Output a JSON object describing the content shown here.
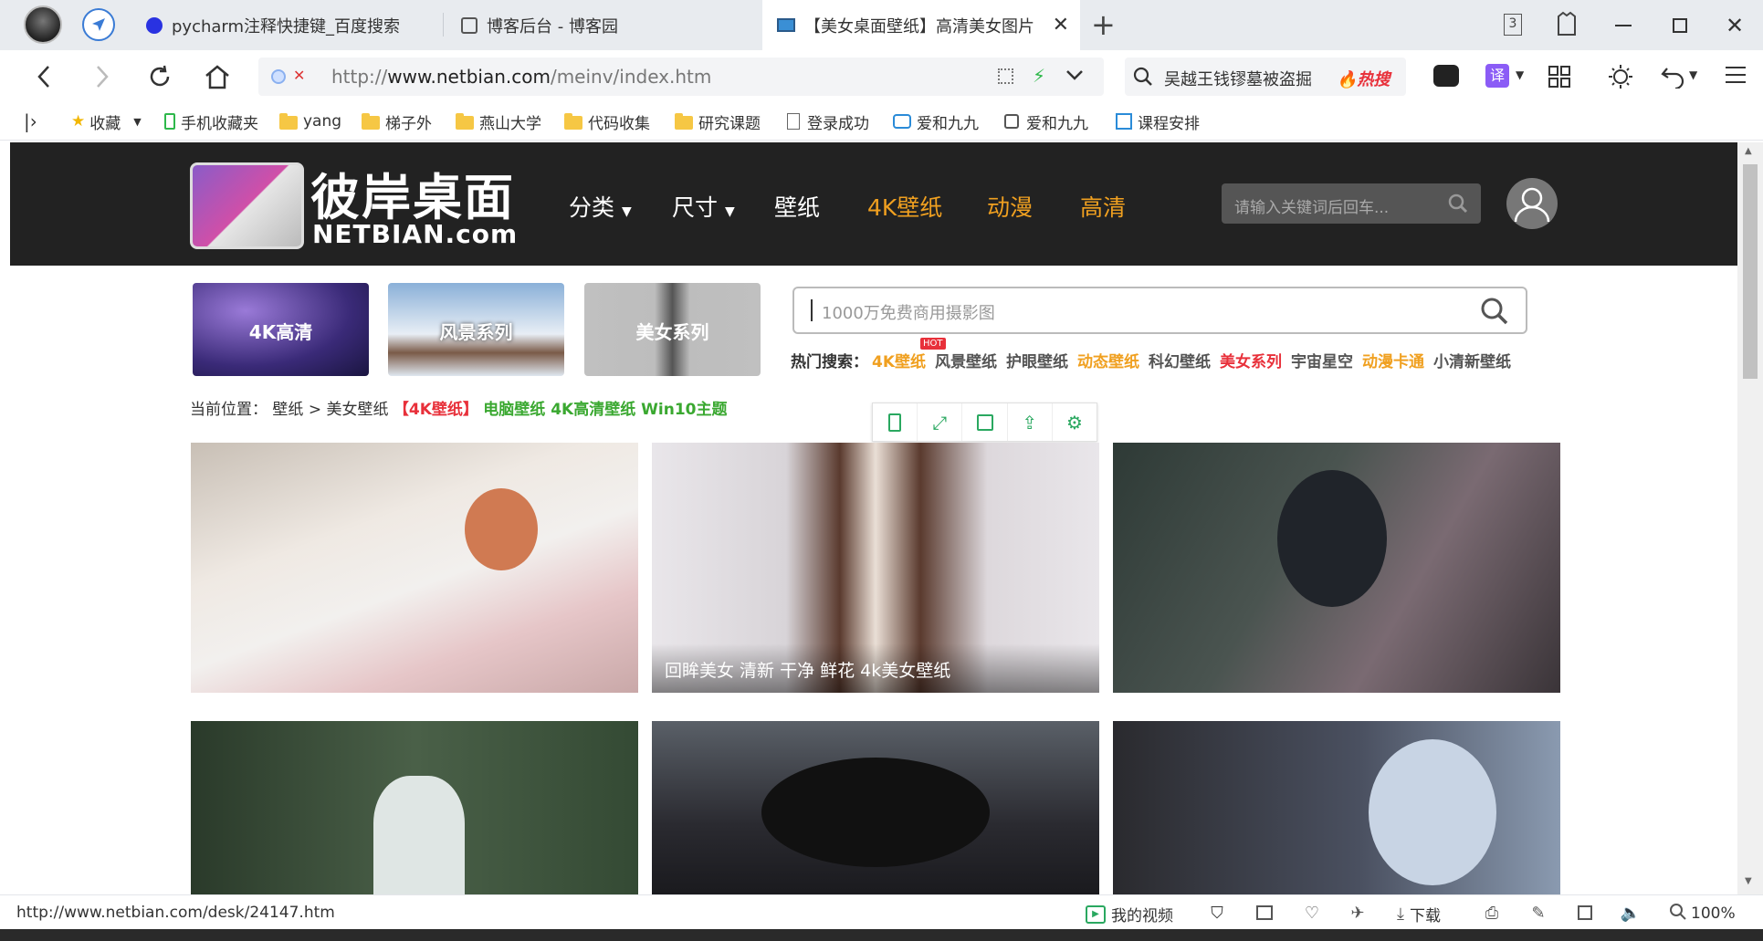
{
  "browser": {
    "tabs": [
      {
        "title": "pycharm注释快捷键_百度搜索",
        "active": false
      },
      {
        "title": "博客后台 - 博客园",
        "active": false
      },
      {
        "title": "【美女桌面壁纸】高清美女图片",
        "active": true
      }
    ],
    "tab_count": "3",
    "address": {
      "prefix": "http://",
      "host": "www.netbian.com",
      "path": "/meinv/index.htm"
    },
    "search": {
      "text": "吴越王钱镠墓被盗掘",
      "badge": "热搜"
    },
    "translate_label": "译",
    "bookmarks": [
      "收藏",
      "手机收藏夹",
      "yang",
      "梯子外",
      "燕山大学",
      "代码收集",
      "研究课题",
      "登录成功",
      "爱和九九",
      "爱和九九",
      "课程安排"
    ]
  },
  "site": {
    "logo": {
      "cn": "彼岸桌面",
      "en": "NETBIAN.com"
    },
    "nav": [
      {
        "label": "分类",
        "dropdown": true,
        "color": "#ffffff"
      },
      {
        "label": "尺寸",
        "dropdown": true,
        "color": "#ffffff"
      },
      {
        "label": "壁纸",
        "dropdown": false,
        "color": "#ffffff"
      },
      {
        "label": "4K壁纸",
        "dropdown": false,
        "color": "#f0a020"
      },
      {
        "label": "动漫",
        "dropdown": false,
        "color": "#f0a020"
      },
      {
        "label": "高清",
        "dropdown": false,
        "color": "#f0a020"
      }
    ],
    "header_search_placeholder": "请输入关键词后回车...",
    "categories": [
      "4K高清",
      "风景系列",
      "美女系列"
    ],
    "big_search_placeholder": "1000万免费商用摄影图",
    "hot_label": "热门搜索：",
    "hot_badge": "HOT",
    "hot_tags": [
      {
        "label": "4K壁纸",
        "color": "#f0a020"
      },
      {
        "label": "风景壁纸",
        "color": "#555555"
      },
      {
        "label": "护眼壁纸",
        "color": "#555555"
      },
      {
        "label": "动态壁纸",
        "color": "#f0a020"
      },
      {
        "label": "科幻壁纸",
        "color": "#555555"
      },
      {
        "label": "美女系列",
        "color": "#e8303a"
      },
      {
        "label": "宇宙星空",
        "color": "#555555"
      },
      {
        "label": "动漫卡通",
        "color": "#f0a020"
      },
      {
        "label": "小清新壁纸",
        "color": "#555555"
      }
    ],
    "breadcrumb": {
      "label": "当前位置：",
      "home": "壁纸",
      "sep": ">",
      "current": "美女壁纸",
      "link_4k": "【4K壁纸】",
      "links_green": "电脑壁纸 4K高清壁纸 Win10主题"
    },
    "gallery": [
      {
        "caption": ""
      },
      {
        "caption": "回眸美女 清新 干净 鲜花 4k美女壁纸"
      },
      {
        "caption": ""
      },
      {
        "caption": ""
      },
      {
        "caption": ""
      },
      {
        "caption": ""
      }
    ]
  },
  "status": {
    "url": "http://www.netbian.com/desk/24147.htm",
    "video_label": "我的视频",
    "download_label": "下载",
    "zoom": "100%"
  }
}
